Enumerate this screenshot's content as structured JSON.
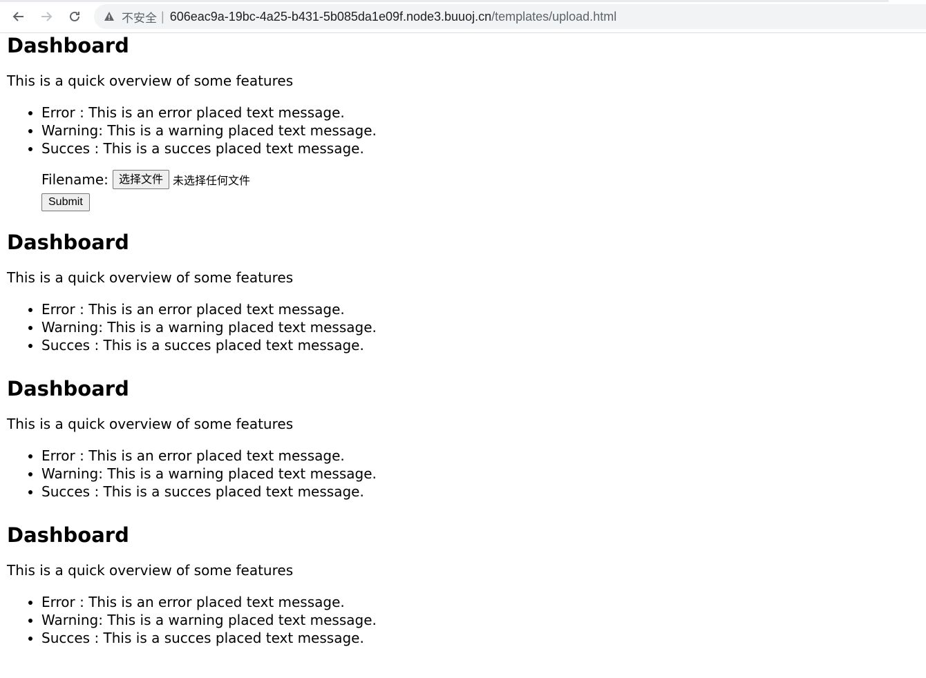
{
  "browser": {
    "security_label": "不安全",
    "separator": "|",
    "url_host": "606eac9a-19bc-4a25-b431-5b085da1e09f.node3.buuoj.cn",
    "url_path": "/templates/upload.html"
  },
  "sections": [
    {
      "title": "Dashboard",
      "lead": "This is a quick overview of some features",
      "items": [
        "Error : This is an error placed text message.",
        "Warning: This is a warning placed text message.",
        "Succes : This is a succes placed text message."
      ]
    },
    {
      "title": "Dashboard",
      "lead": "This is a quick overview of some features",
      "items": [
        "Error : This is an error placed text message.",
        "Warning: This is a warning placed text message.",
        "Succes : This is a succes placed text message."
      ]
    },
    {
      "title": "Dashboard",
      "lead": "This is a quick overview of some features",
      "items": [
        "Error : This is an error placed text message.",
        "Warning: This is a warning placed text message.",
        "Succes : This is a succes placed text message."
      ]
    },
    {
      "title": "Dashboard",
      "lead": "This is a quick overview of some features",
      "items": [
        "Error : This is an error placed text message.",
        "Warning: This is a warning placed text message.",
        "Succes : This is a succes placed text message."
      ]
    }
  ],
  "upload_form": {
    "filename_label": "Filename:",
    "choose_file_label": "选择文件",
    "no_file_text": "未选择任何文件",
    "submit_label": "Submit"
  }
}
